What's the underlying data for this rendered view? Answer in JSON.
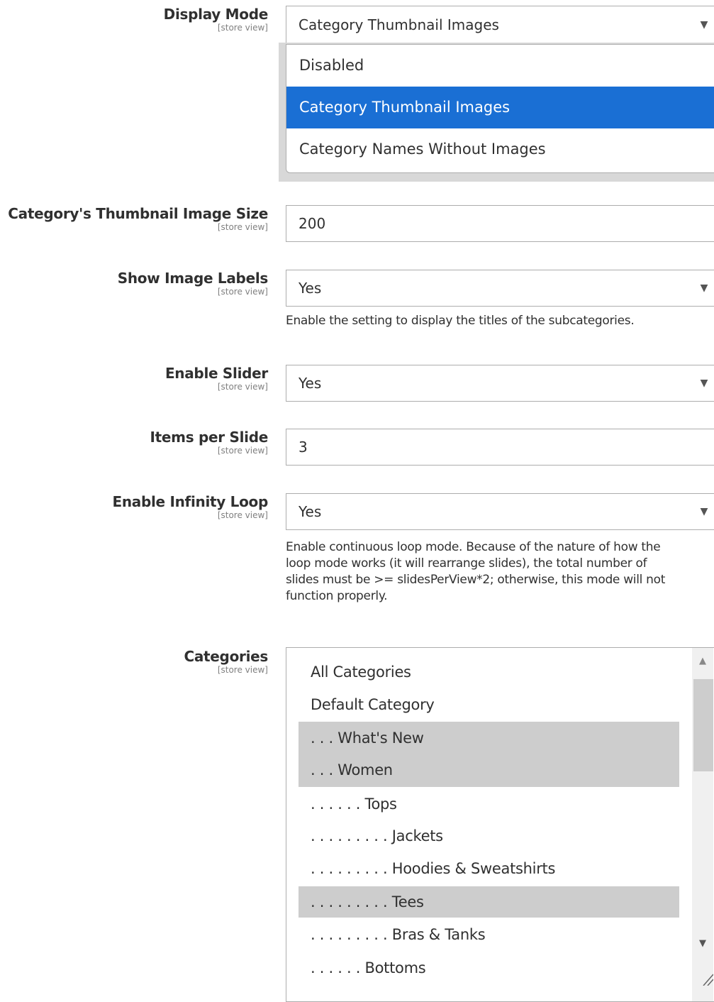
{
  "display_mode": {
    "label": "Display Mode",
    "scope": "[store view]",
    "value": "Category Thumbnail Images",
    "arrow_icon": "chevron-down-icon",
    "options": [
      "Disabled",
      "Category Thumbnail Images",
      "Category Names Without Images"
    ],
    "highlighted_option": "Category Thumbnail Images",
    "highlight_color": "#1a6fd4"
  },
  "thumbnail_size": {
    "label": "Category's Thumbnail Image Size",
    "scope": "[store view]",
    "value": "200"
  },
  "show_image_labels": {
    "label": "Show Image Labels",
    "scope": "[store view]",
    "value": "Yes",
    "note": "Enable the setting to display the titles of the subcategories."
  },
  "enable_slider": {
    "label": "Enable Slider",
    "scope": "[store view]",
    "value": "Yes"
  },
  "items_per_slide": {
    "label": "Items per Slide",
    "scope": "[store view]",
    "value": "3"
  },
  "infinity_loop": {
    "label": "Enable Infinity Loop",
    "scope": "[store view]",
    "value": "Yes",
    "note_lines": [
      "Enable continuous loop mode. Because of the nature of how the",
      "loop mode works (it will rearrange slides), the total number of",
      "slides must be >= slidesPerView*2; otherwise, this mode will not",
      "function properly."
    ]
  },
  "categories": {
    "label": "Categories",
    "scope": "[store view]",
    "items": [
      {
        "label": "All Categories",
        "selected": false
      },
      {
        "label": "Default Category",
        "selected": false
      },
      {
        "label": ". . . What's New",
        "selected": true
      },
      {
        "label": ". . . Women",
        "selected": true
      },
      {
        "label": ". . . . . . Tops",
        "selected": false
      },
      {
        "label": ". . . . . . . . . Jackets",
        "selected": false
      },
      {
        "label": ". . . . . . . . . Hoodies & Sweatshirts",
        "selected": false
      },
      {
        "label": ". . . . . . . . . Tees",
        "selected": true
      },
      {
        "label": ". . . . . . . . . Bras & Tanks",
        "selected": false
      },
      {
        "label": ". . . . . . Bottoms",
        "selected": false
      }
    ],
    "selected_color": "#cdcdcd"
  }
}
